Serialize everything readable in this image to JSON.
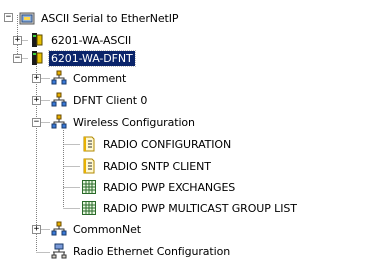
{
  "tree": {
    "root": {
      "label": "ASCII Serial to EtherNetIP",
      "expander": "−",
      "icon": "project-folder-icon",
      "children": [
        {
          "label": "6201-WA-ASCII",
          "expander": "+",
          "icon": "module-icon"
        },
        {
          "label": "6201-WA-DFNT",
          "expander": "−",
          "icon": "module-icon",
          "selected": true,
          "children": [
            {
              "label": "Comment",
              "expander": "+",
              "icon": "network-group-icon"
            },
            {
              "label": "DFNT Client 0",
              "expander": "+",
              "icon": "network-group-icon"
            },
            {
              "label": "Wireless Configuration",
              "expander": "−",
              "icon": "network-group-icon",
              "children": [
                {
                  "label": "RADIO CONFIGURATION",
                  "icon": "config-doc-icon"
                },
                {
                  "label": "RADIO SNTP CLIENT",
                  "icon": "config-doc-icon"
                },
                {
                  "label": "RADIO PWP EXCHANGES",
                  "icon": "grid-table-icon"
                },
                {
                  "label": "RADIO PWP MULTICAST GROUP LIST",
                  "icon": "grid-table-icon"
                }
              ]
            },
            {
              "label": "CommonNet",
              "expander": "+",
              "icon": "network-group-icon"
            },
            {
              "label": "Radio Ethernet Configuration",
              "icon": "network-config-icon"
            }
          ]
        }
      ]
    }
  },
  "colors": {
    "selection_bg": "#0a246a",
    "selection_fg": "#ffffff",
    "tree_line": "#808080"
  }
}
